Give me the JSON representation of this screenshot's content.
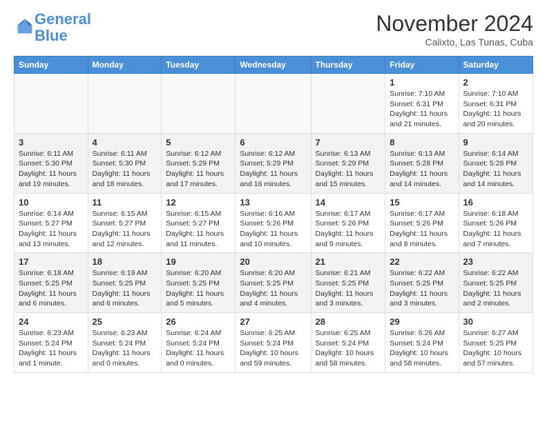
{
  "logo": {
    "text_general": "General",
    "text_blue": "Blue"
  },
  "header": {
    "title": "November 2024",
    "subtitle": "Calixto, Las Tunas, Cuba"
  },
  "weekdays": [
    "Sunday",
    "Monday",
    "Tuesday",
    "Wednesday",
    "Thursday",
    "Friday",
    "Saturday"
  ],
  "weeks": [
    [
      {
        "day": "",
        "info": ""
      },
      {
        "day": "",
        "info": ""
      },
      {
        "day": "",
        "info": ""
      },
      {
        "day": "",
        "info": ""
      },
      {
        "day": "",
        "info": ""
      },
      {
        "day": "1",
        "info": "Sunrise: 7:10 AM\nSunset: 6:31 PM\nDaylight: 11 hours and 21 minutes."
      },
      {
        "day": "2",
        "info": "Sunrise: 7:10 AM\nSunset: 6:31 PM\nDaylight: 11 hours and 20 minutes."
      }
    ],
    [
      {
        "day": "3",
        "info": "Sunrise: 6:11 AM\nSunset: 5:30 PM\nDaylight: 11 hours and 19 minutes."
      },
      {
        "day": "4",
        "info": "Sunrise: 6:11 AM\nSunset: 5:30 PM\nDaylight: 11 hours and 18 minutes."
      },
      {
        "day": "5",
        "info": "Sunrise: 6:12 AM\nSunset: 5:29 PM\nDaylight: 11 hours and 17 minutes."
      },
      {
        "day": "6",
        "info": "Sunrise: 6:12 AM\nSunset: 5:29 PM\nDaylight: 11 hours and 16 minutes."
      },
      {
        "day": "7",
        "info": "Sunrise: 6:13 AM\nSunset: 5:29 PM\nDaylight: 11 hours and 15 minutes."
      },
      {
        "day": "8",
        "info": "Sunrise: 6:13 AM\nSunset: 5:28 PM\nDaylight: 11 hours and 14 minutes."
      },
      {
        "day": "9",
        "info": "Sunrise: 6:14 AM\nSunset: 5:28 PM\nDaylight: 11 hours and 14 minutes."
      }
    ],
    [
      {
        "day": "10",
        "info": "Sunrise: 6:14 AM\nSunset: 5:27 PM\nDaylight: 11 hours and 13 minutes."
      },
      {
        "day": "11",
        "info": "Sunrise: 6:15 AM\nSunset: 5:27 PM\nDaylight: 11 hours and 12 minutes."
      },
      {
        "day": "12",
        "info": "Sunrise: 6:15 AM\nSunset: 5:27 PM\nDaylight: 11 hours and 11 minutes."
      },
      {
        "day": "13",
        "info": "Sunrise: 6:16 AM\nSunset: 5:26 PM\nDaylight: 11 hours and 10 minutes."
      },
      {
        "day": "14",
        "info": "Sunrise: 6:17 AM\nSunset: 5:26 PM\nDaylight: 11 hours and 9 minutes."
      },
      {
        "day": "15",
        "info": "Sunrise: 6:17 AM\nSunset: 5:26 PM\nDaylight: 11 hours and 8 minutes."
      },
      {
        "day": "16",
        "info": "Sunrise: 6:18 AM\nSunset: 5:26 PM\nDaylight: 11 hours and 7 minutes."
      }
    ],
    [
      {
        "day": "17",
        "info": "Sunrise: 6:18 AM\nSunset: 5:25 PM\nDaylight: 11 hours and 6 minutes."
      },
      {
        "day": "18",
        "info": "Sunrise: 6:19 AM\nSunset: 5:25 PM\nDaylight: 11 hours and 6 minutes."
      },
      {
        "day": "19",
        "info": "Sunrise: 6:20 AM\nSunset: 5:25 PM\nDaylight: 11 hours and 5 minutes."
      },
      {
        "day": "20",
        "info": "Sunrise: 6:20 AM\nSunset: 5:25 PM\nDaylight: 11 hours and 4 minutes."
      },
      {
        "day": "21",
        "info": "Sunrise: 6:21 AM\nSunset: 5:25 PM\nDaylight: 11 hours and 3 minutes."
      },
      {
        "day": "22",
        "info": "Sunrise: 6:22 AM\nSunset: 5:25 PM\nDaylight: 11 hours and 3 minutes."
      },
      {
        "day": "23",
        "info": "Sunrise: 6:22 AM\nSunset: 5:25 PM\nDaylight: 11 hours and 2 minutes."
      }
    ],
    [
      {
        "day": "24",
        "info": "Sunrise: 6:23 AM\nSunset: 5:24 PM\nDaylight: 11 hours and 1 minute."
      },
      {
        "day": "25",
        "info": "Sunrise: 6:23 AM\nSunset: 5:24 PM\nDaylight: 11 hours and 0 minutes."
      },
      {
        "day": "26",
        "info": "Sunrise: 6:24 AM\nSunset: 5:24 PM\nDaylight: 11 hours and 0 minutes."
      },
      {
        "day": "27",
        "info": "Sunrise: 6:25 AM\nSunset: 5:24 PM\nDaylight: 10 hours and 59 minutes."
      },
      {
        "day": "28",
        "info": "Sunrise: 6:25 AM\nSunset: 5:24 PM\nDaylight: 10 hours and 58 minutes."
      },
      {
        "day": "29",
        "info": "Sunrise: 6:26 AM\nSunset: 5:24 PM\nDaylight: 10 hours and 58 minutes."
      },
      {
        "day": "30",
        "info": "Sunrise: 6:27 AM\nSunset: 5:25 PM\nDaylight: 10 hours and 57 minutes."
      }
    ]
  ]
}
